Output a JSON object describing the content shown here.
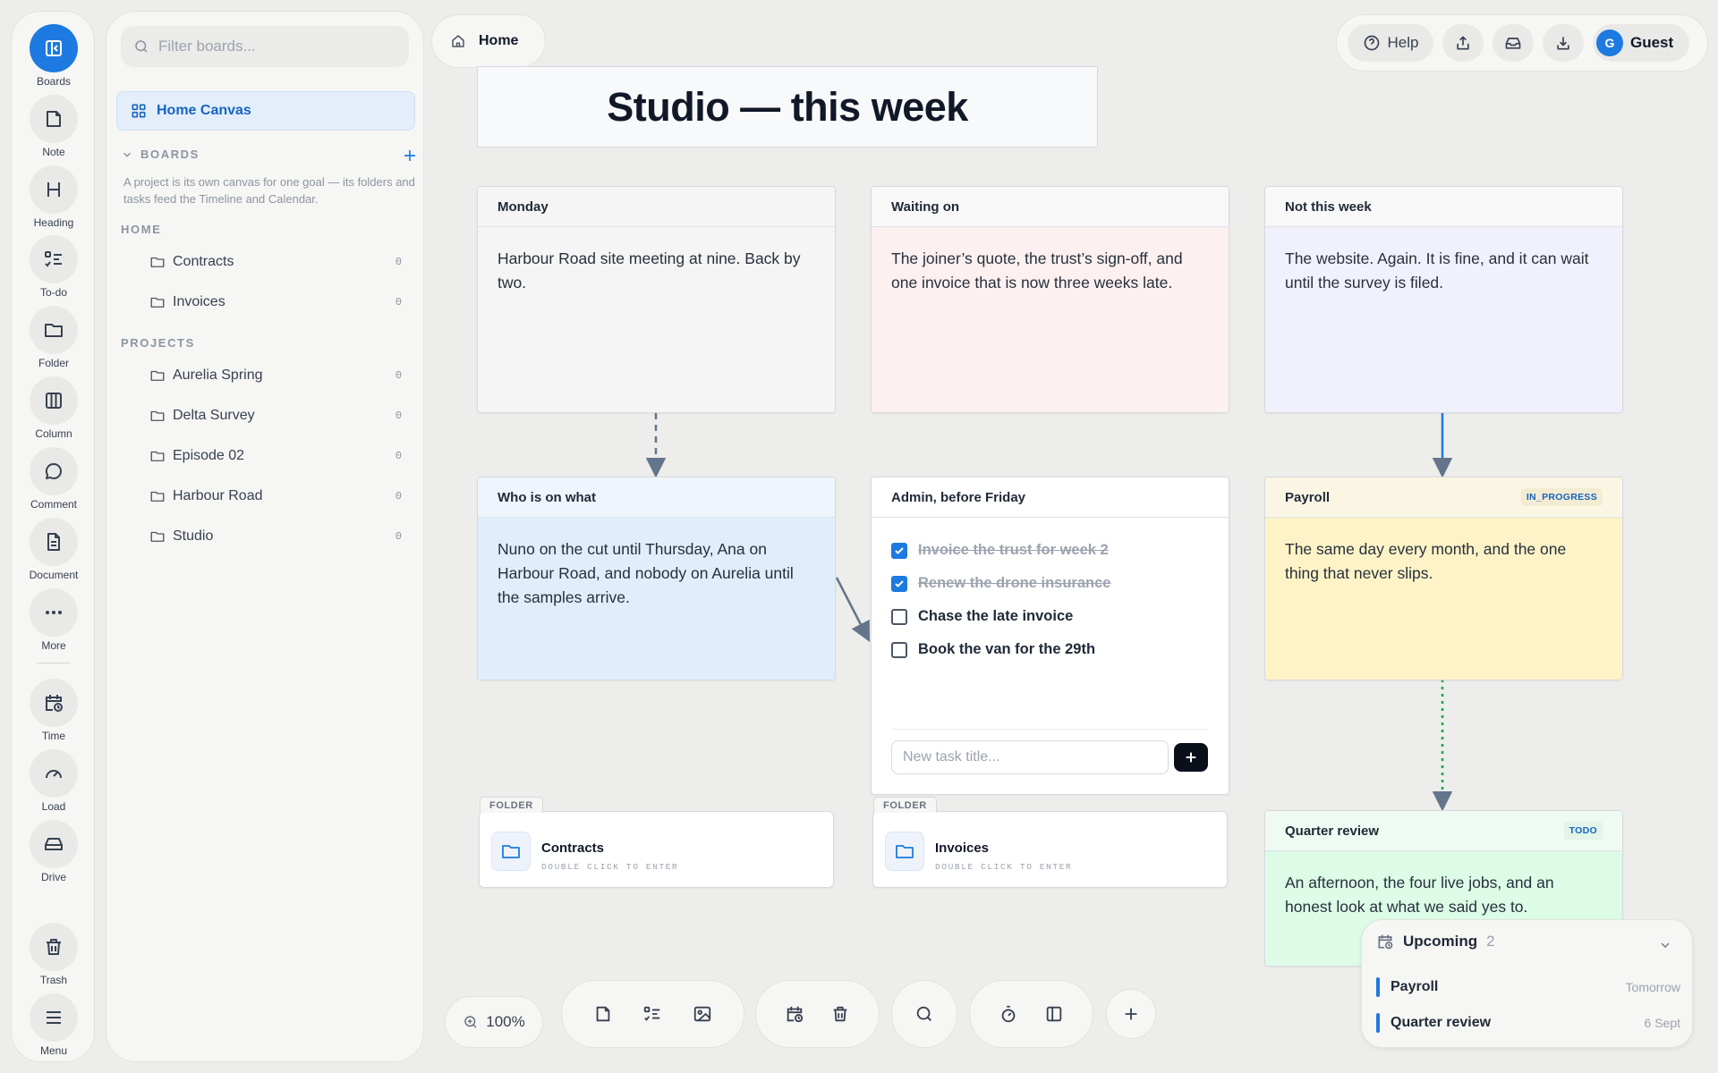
{
  "rail": {
    "items": [
      {
        "label": "Boards",
        "icon": "sidebar-panel-icon"
      },
      {
        "label": "Note",
        "icon": "note-icon"
      },
      {
        "label": "Heading",
        "icon": "heading-icon"
      },
      {
        "label": "To-do",
        "icon": "checklist-icon"
      },
      {
        "label": "Folder",
        "icon": "folder-icon"
      },
      {
        "label": "Column",
        "icon": "column-icon"
      },
      {
        "label": "Comment",
        "icon": "comment-icon"
      },
      {
        "label": "Document",
        "icon": "document-icon"
      },
      {
        "label": "More",
        "icon": "more-icon"
      },
      {
        "label": "Time",
        "icon": "calendar-clock-icon"
      },
      {
        "label": "Load",
        "icon": "gauge-icon"
      },
      {
        "label": "Drive",
        "icon": "drive-icon"
      },
      {
        "label": "Trash",
        "icon": "trash-icon"
      },
      {
        "label": "Menu",
        "icon": "menu-icon"
      }
    ]
  },
  "sidebar": {
    "filter_placeholder": "Filter boards...",
    "home_canvas": "Home Canvas",
    "boards_heading": "BOARDS",
    "boards_help": "A project is its own canvas for one goal — its folders and tasks feed the Timeline and Calendar.",
    "home_heading": "HOME",
    "home_folders": [
      {
        "name": "Contracts",
        "count": "0"
      },
      {
        "name": "Invoices",
        "count": "0"
      }
    ],
    "projects_heading": "PROJECTS",
    "projects": [
      {
        "name": "Aurelia Spring",
        "count": "0"
      },
      {
        "name": "Delta Survey",
        "count": "0"
      },
      {
        "name": "Episode 02",
        "count": "0"
      },
      {
        "name": "Harbour Road",
        "count": "0"
      },
      {
        "name": "Studio",
        "count": "0"
      }
    ]
  },
  "topbar": {
    "home_tab": "Home",
    "help": "Help",
    "user_initial": "G",
    "user_name": "Guest"
  },
  "canvas": {
    "title": "Studio — this week",
    "cards": {
      "monday": {
        "title": "Monday",
        "body": "Harbour Road site meeting at nine. Back by two."
      },
      "waiting": {
        "title": "Waiting on",
        "body": "The joiner’s quote, the trust’s sign-off, and one invoice that is now three weeks late."
      },
      "not_this_week": {
        "title": "Not this week",
        "body": "The website. Again. It is fine, and it can wait until the survey is filed."
      },
      "who": {
        "title": "Who is on what",
        "body": "Nuno on the cut until Thursday, Ana on Harbour Road, and nobody on Aurelia until the samples arrive."
      },
      "admin": {
        "title": "Admin, before Friday",
        "tasks": [
          {
            "text": "Invoice the trust for week 2",
            "done": true
          },
          {
            "text": "Renew the drone insurance",
            "done": true
          },
          {
            "text": "Chase the late invoice",
            "done": false
          },
          {
            "text": "Book the van for the 29th",
            "done": false
          }
        ],
        "new_task_placeholder": "New task title..."
      },
      "payroll": {
        "title": "Payroll",
        "badge": "IN_PROGRESS",
        "body": "The same day every month, and the one thing that never slips."
      },
      "quarter": {
        "title": "Quarter review",
        "badge": "TODO",
        "body": "An afternoon, the four live jobs, and an honest look at what we said yes to."
      }
    },
    "folders": [
      {
        "tag": "FOLDER",
        "name": "Contracts",
        "hint": "DOUBLE CLICK TO ENTER"
      },
      {
        "tag": "FOLDER",
        "name": "Invoices",
        "hint": "DOUBLE CLICK TO ENTER"
      }
    ],
    "colors": {
      "monday": "#f5f5f5",
      "waiting": "#fdf0f0",
      "not_this_week": "#f1f1fd",
      "who": "#e0eefc",
      "payroll": "#fef3c7",
      "quarter": "#dcfce7",
      "accent": "#1d7ae0"
    }
  },
  "bottom": {
    "zoom": "100%"
  },
  "upcoming": {
    "title": "Upcoming",
    "count": "2",
    "items": [
      {
        "name": "Payroll",
        "when": "Tomorrow"
      },
      {
        "name": "Quarter review",
        "when": "6 Sept"
      }
    ]
  }
}
